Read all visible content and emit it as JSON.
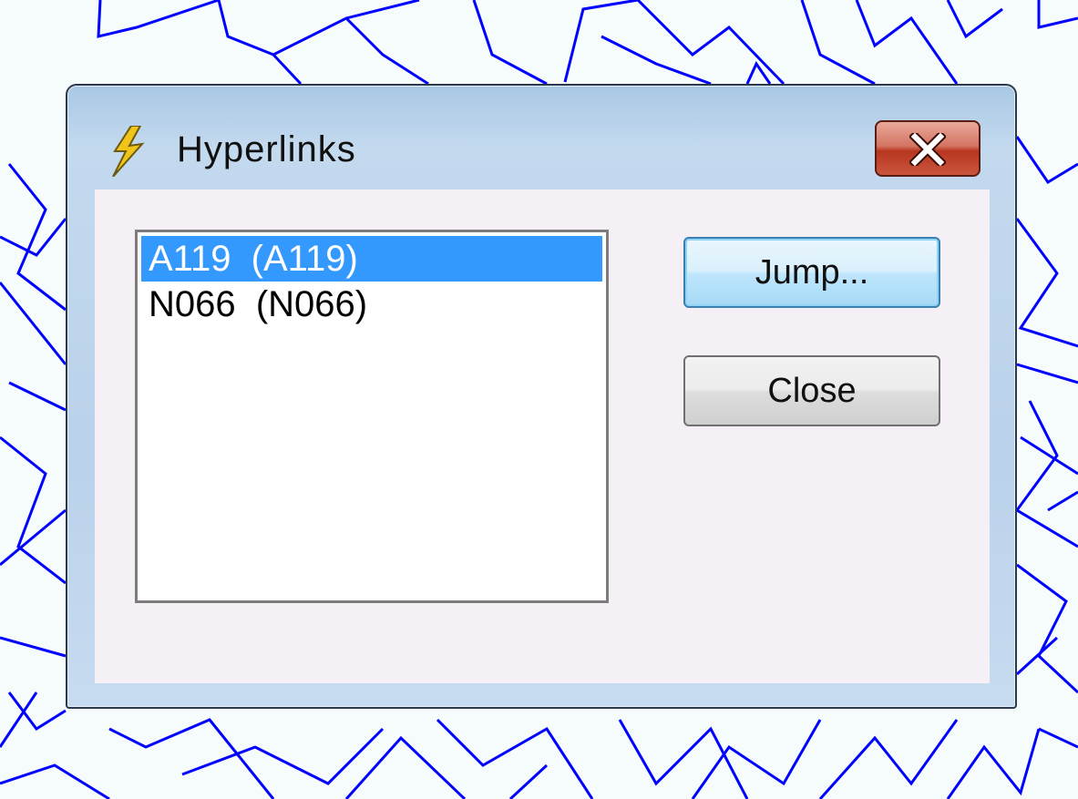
{
  "dialog": {
    "title": "Hyperlinks",
    "icon": "lightning-icon",
    "close_icon": "close-icon"
  },
  "list": {
    "items": [
      {
        "label": "A119  (A119)",
        "selected": true
      },
      {
        "label": "N066  (N066)",
        "selected": false
      }
    ]
  },
  "buttons": {
    "jump_label": "Jump...",
    "close_label": "Close"
  },
  "colors": {
    "background_lines": "#0000ff",
    "selection": "#3399ff"
  }
}
